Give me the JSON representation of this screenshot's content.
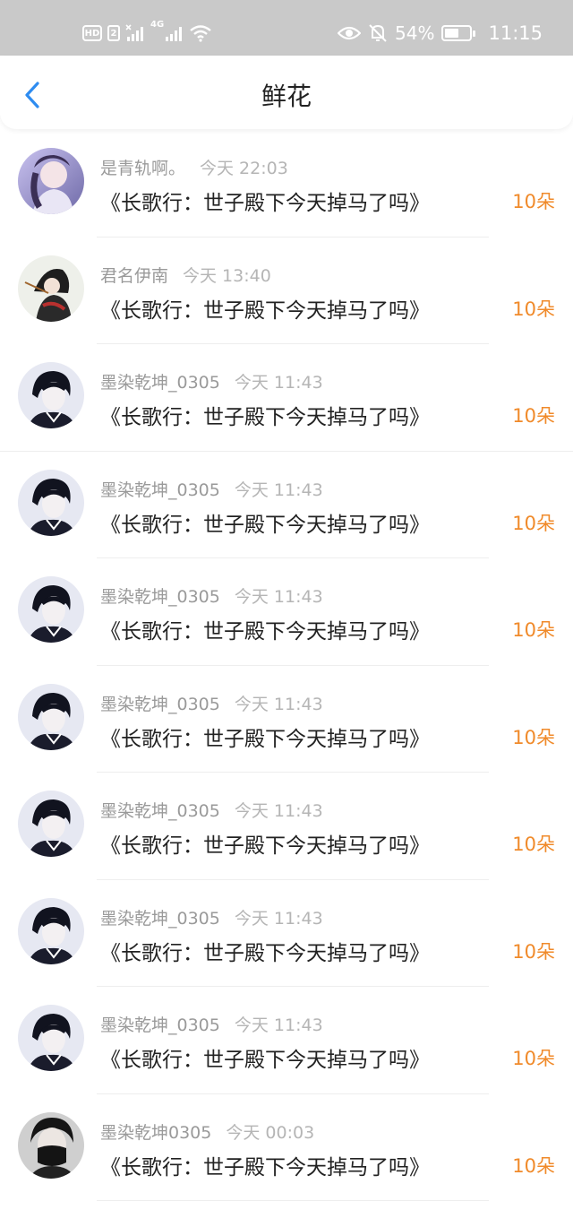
{
  "status_bar": {
    "hd": "HD",
    "sim": "2",
    "signal_4g": "4G",
    "battery_percent": "54%",
    "battery_level": 0.54,
    "time": "11:15"
  },
  "header": {
    "title": "鲜花"
  },
  "items": [
    {
      "name": "是青轨啊。",
      "time": "今天 22:03",
      "title": "《长歌行：世子殿下今天掉马了吗》",
      "count": "10朵",
      "avatar": "avatar-1"
    },
    {
      "name": "君名伊南",
      "time": "今天 13:40",
      "title": "《长歌行：世子殿下今天掉马了吗》",
      "count": "10朵",
      "avatar": "avatar-2"
    },
    {
      "name": "墨染乾坤_0305",
      "time": "今天 11:43",
      "title": "《长歌行：世子殿下今天掉马了吗》",
      "count": "10朵",
      "avatar": "avatar-3"
    },
    {
      "name": "墨染乾坤_0305",
      "time": "今天 11:43",
      "title": "《长歌行：世子殿下今天掉马了吗》",
      "count": "10朵",
      "avatar": "avatar-3"
    },
    {
      "name": "墨染乾坤_0305",
      "time": "今天 11:43",
      "title": "《长歌行：世子殿下今天掉马了吗》",
      "count": "10朵",
      "avatar": "avatar-3"
    },
    {
      "name": "墨染乾坤_0305",
      "time": "今天 11:43",
      "title": "《长歌行：世子殿下今天掉马了吗》",
      "count": "10朵",
      "avatar": "avatar-3"
    },
    {
      "name": "墨染乾坤_0305",
      "time": "今天 11:43",
      "title": "《长歌行：世子殿下今天掉马了吗》",
      "count": "10朵",
      "avatar": "avatar-3"
    },
    {
      "name": "墨染乾坤_0305",
      "time": "今天 11:43",
      "title": "《长歌行：世子殿下今天掉马了吗》",
      "count": "10朵",
      "avatar": "avatar-3"
    },
    {
      "name": "墨染乾坤_0305",
      "time": "今天 11:43",
      "title": "《长歌行：世子殿下今天掉马了吗》",
      "count": "10朵",
      "avatar": "avatar-3"
    },
    {
      "name": "墨染乾坤0305",
      "time": "今天 00:03",
      "title": "《长歌行：世子殿下今天掉马了吗》",
      "count": "10朵",
      "avatar": "avatar-4"
    }
  ],
  "colors": {
    "accent": "#2e8cf0",
    "count": "#f08a2a",
    "status_bar": "#c9c9c9"
  }
}
